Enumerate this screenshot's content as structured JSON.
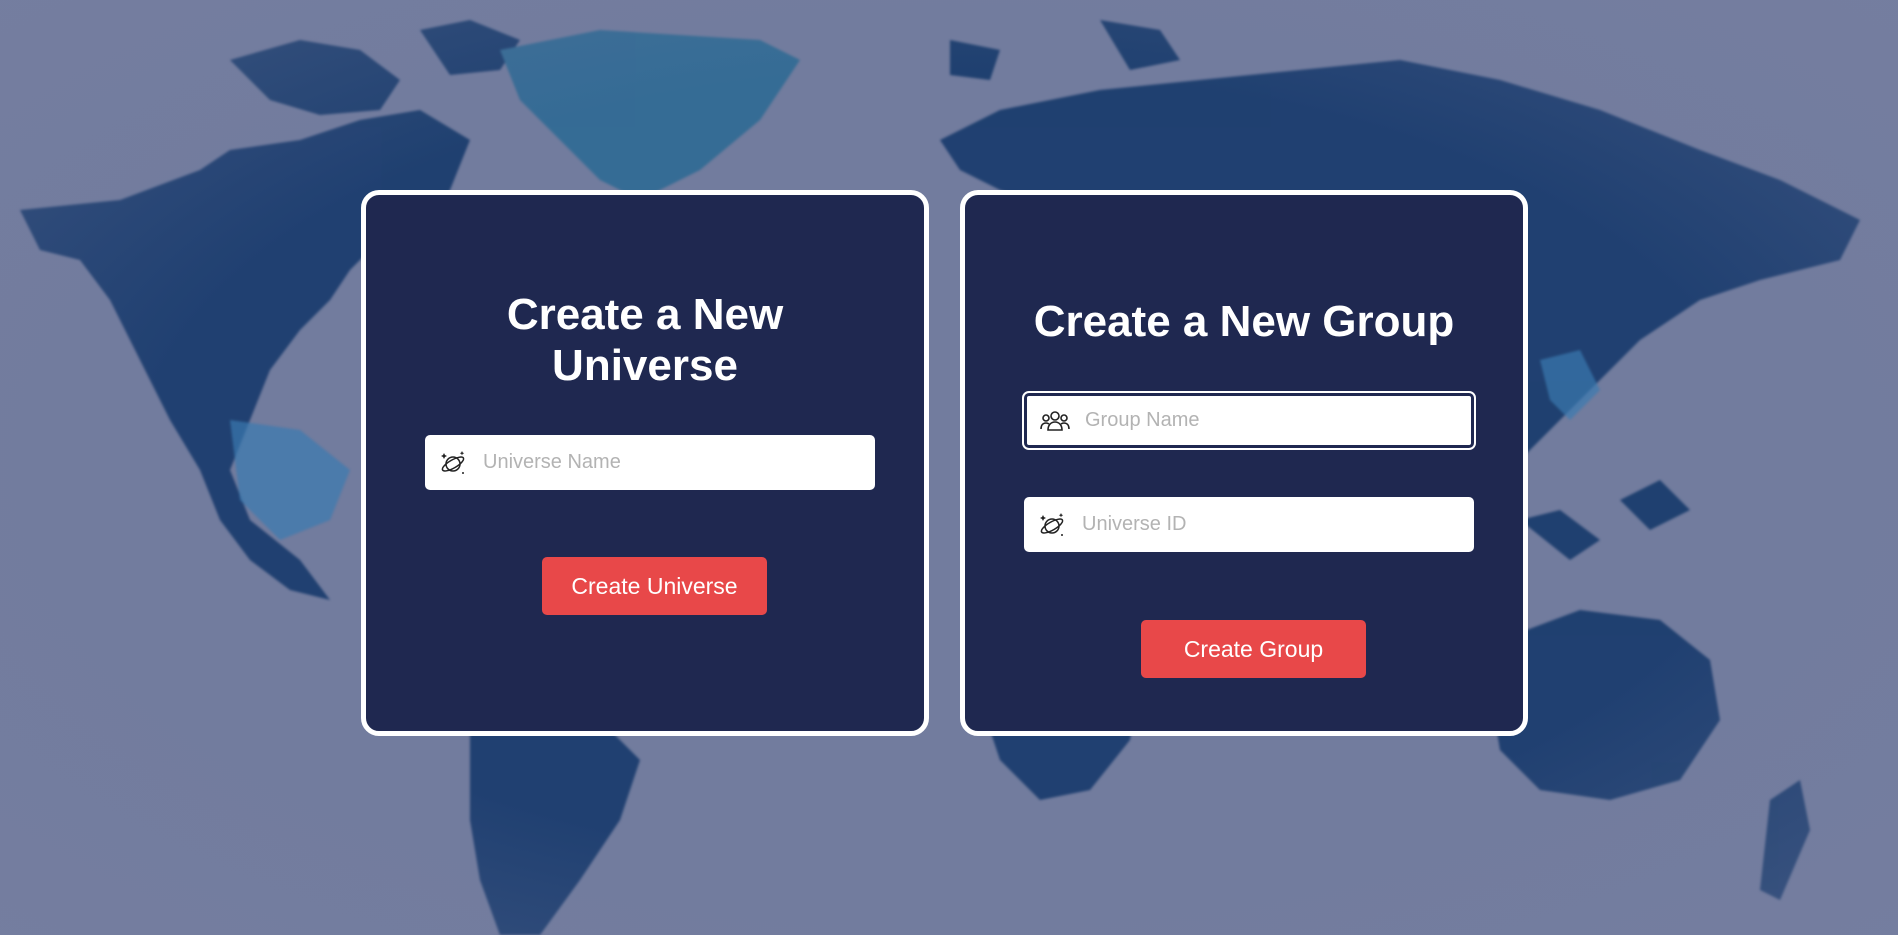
{
  "universe_card": {
    "title": "Create a New Universe",
    "name_input": {
      "placeholder": "Universe Name",
      "value": "",
      "icon": "planet-icon"
    },
    "submit_label": "Create Universe"
  },
  "group_card": {
    "title": "Create a New Group",
    "name_input": {
      "placeholder": "Group Name",
      "value": "",
      "icon": "users-icon"
    },
    "universe_id_input": {
      "placeholder": "Universe ID",
      "value": "",
      "icon": "planet-icon"
    },
    "submit_label": "Create Group"
  },
  "colors": {
    "card_background": "#1f2850",
    "card_border": "#ffffff",
    "accent_button": "#e84849",
    "page_background": "#727c9e",
    "map_land": "#173a6b"
  }
}
